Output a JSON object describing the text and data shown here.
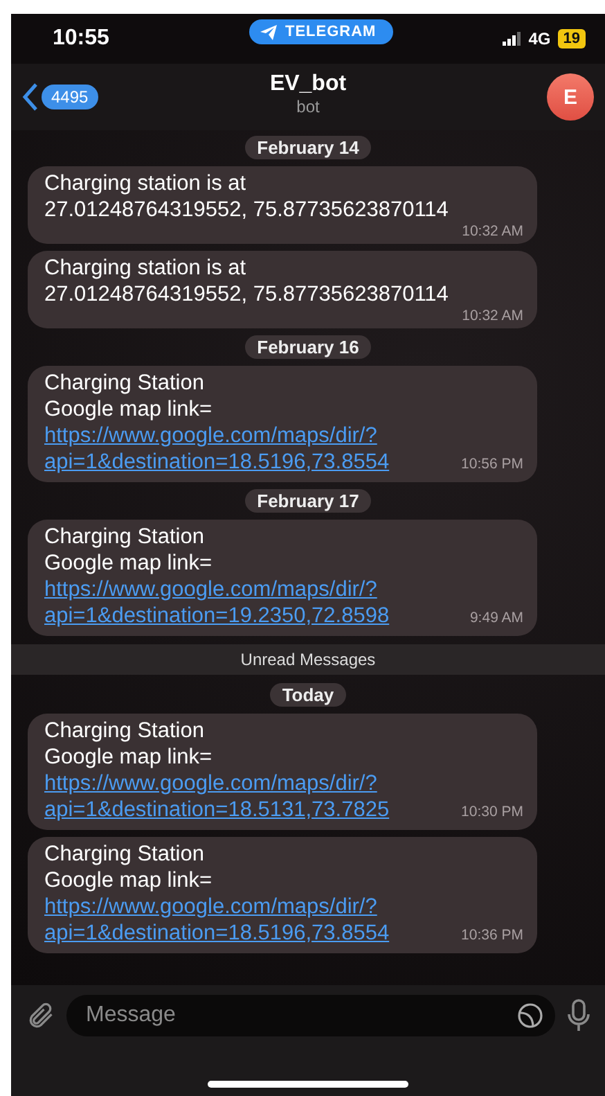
{
  "status_bar": {
    "time": "10:55",
    "app_pill": "TELEGRAM",
    "network": "4G",
    "battery": "19"
  },
  "header": {
    "back_count": "4495",
    "title": "EV_bot",
    "subtitle": "bot",
    "avatar_letter": "E"
  },
  "messages": [
    {
      "kind": "date",
      "text": "February 14"
    },
    {
      "kind": "message",
      "lines": [
        "Charging station is at",
        "27.01248764319552, 75.87735623870114"
      ],
      "time": "10:32 AM"
    },
    {
      "kind": "message",
      "lines": [
        "Charging station is at",
        "27.01248764319552, 75.87735623870114"
      ],
      "time": "10:32 AM"
    },
    {
      "kind": "date",
      "text": "February 16"
    },
    {
      "kind": "message",
      "lines": [
        "Charging Station",
        "Google map link="
      ],
      "link_lines": [
        "https://www.google.com/maps/dir/?",
        "api=1&destination=18.5196,73.8554"
      ],
      "time": "10:56 PM"
    },
    {
      "kind": "date",
      "text": "February 17"
    },
    {
      "kind": "message",
      "lines": [
        "Charging Station",
        "Google map link="
      ],
      "link_lines": [
        "https://www.google.com/maps/dir/?",
        "api=1&destination=19.2350,72.8598"
      ],
      "time": "9:49 AM"
    },
    {
      "kind": "divider",
      "text": "Unread Messages"
    },
    {
      "kind": "date",
      "text": "Today"
    },
    {
      "kind": "message",
      "lines": [
        "Charging Station",
        "Google map link="
      ],
      "link_lines": [
        "https://www.google.com/maps/dir/?",
        "api=1&destination=18.5131,73.7825"
      ],
      "time": "10:30 PM"
    },
    {
      "kind": "message",
      "lines": [
        "Charging Station",
        "Google map link="
      ],
      "link_lines": [
        "https://www.google.com/maps/dir/?",
        "api=1&destination=18.5196,73.8554"
      ],
      "time": "10:36 PM"
    }
  ],
  "composer": {
    "placeholder": "Message"
  }
}
